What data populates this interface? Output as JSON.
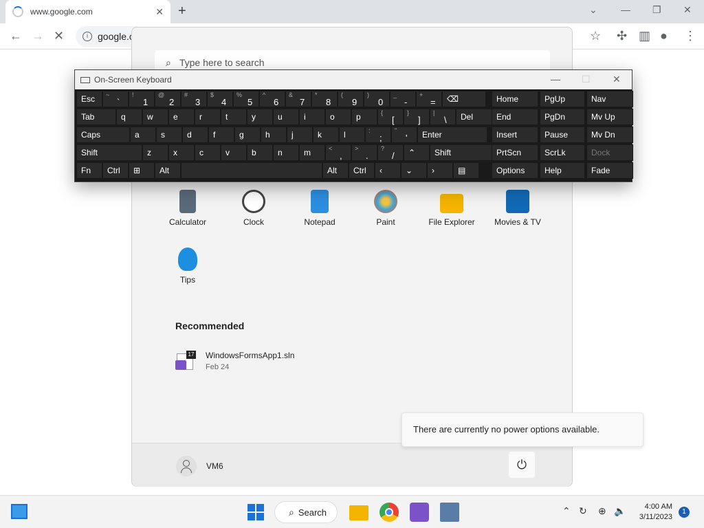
{
  "browser": {
    "tab_title": "www.google.com",
    "tab_close": "✕",
    "new_tab": "+",
    "url": "google.c"
  },
  "start_menu": {
    "search_placeholder": "Type here to search",
    "apps": [
      {
        "label": "Calculator",
        "icon": "calculator-icon",
        "color": "#5a6a7a"
      },
      {
        "label": "Clock",
        "icon": "clock-icon",
        "color": "#444444"
      },
      {
        "label": "Notepad",
        "icon": "notepad-icon",
        "color": "#2d8ee0"
      },
      {
        "label": "Paint",
        "icon": "paint-icon",
        "color": "#e36b2c"
      },
      {
        "label": "File Explorer",
        "icon": "folder-icon",
        "color": "#f4b400"
      },
      {
        "label": "Movies & TV",
        "icon": "movies-icon",
        "color": "#1269b5"
      },
      {
        "label": "Tips",
        "icon": "tips-icon",
        "color": "#1d8fe1"
      }
    ],
    "recommended_title": "Recommended",
    "recommended": [
      {
        "name": "WindowsFormsApp1.sln",
        "date": "Feb 24",
        "badge": "17"
      }
    ],
    "user": "VM6",
    "power_tooltip": "There are currently no power options available."
  },
  "osk": {
    "title": "On-Screen Keyboard",
    "rows": [
      [
        {
          "main": "Esc"
        },
        {
          "sub": "~",
          "bot": "`"
        },
        {
          "sub": "!",
          "bot": "1"
        },
        {
          "sub": "@",
          "bot": "2"
        },
        {
          "sub": "#",
          "bot": "3"
        },
        {
          "sub": "$",
          "bot": "4"
        },
        {
          "sub": "%",
          "bot": "5"
        },
        {
          "sub": "^",
          "bot": "6"
        },
        {
          "sub": "&",
          "bot": "7"
        },
        {
          "sub": "*",
          "bot": "8"
        },
        {
          "sub": "(",
          "bot": "9"
        },
        {
          "sub": ")",
          "bot": "0"
        },
        {
          "sub": "_",
          "bot": "-"
        },
        {
          "sub": "+",
          "bot": "="
        },
        {
          "main": "⌫"
        }
      ],
      [
        {
          "main": "Tab"
        },
        {
          "main": "q"
        },
        {
          "main": "w"
        },
        {
          "main": "e"
        },
        {
          "main": "r"
        },
        {
          "main": "t"
        },
        {
          "main": "y"
        },
        {
          "main": "u"
        },
        {
          "main": "i"
        },
        {
          "main": "o"
        },
        {
          "main": "p"
        },
        {
          "sub": "{",
          "bot": "["
        },
        {
          "sub": "}",
          "bot": "]"
        },
        {
          "sub": "|",
          "bot": "\\"
        },
        {
          "main": "Del"
        }
      ],
      [
        {
          "main": "Caps"
        },
        {
          "main": "a"
        },
        {
          "main": "s"
        },
        {
          "main": "d"
        },
        {
          "main": "f"
        },
        {
          "main": "g"
        },
        {
          "main": "h"
        },
        {
          "main": "j"
        },
        {
          "main": "k"
        },
        {
          "main": "l"
        },
        {
          "sub": ":",
          "bot": ";"
        },
        {
          "sub": "\"",
          "bot": "'"
        },
        {
          "main": "Enter"
        }
      ],
      [
        {
          "main": "Shift"
        },
        {
          "main": "z"
        },
        {
          "main": "x"
        },
        {
          "main": "c"
        },
        {
          "main": "v"
        },
        {
          "main": "b"
        },
        {
          "main": "n"
        },
        {
          "main": "m"
        },
        {
          "sub": "<",
          "bot": ","
        },
        {
          "sub": ">",
          "bot": "."
        },
        {
          "sub": "?",
          "bot": "/"
        },
        {
          "main": "⌃"
        },
        {
          "main": "Shift"
        }
      ],
      [
        {
          "main": "Fn"
        },
        {
          "main": "Ctrl"
        },
        {
          "main": "⊞"
        },
        {
          "main": "Alt"
        },
        {
          "main": ""
        },
        {
          "main": "Alt"
        },
        {
          "main": "Ctrl"
        },
        {
          "main": "‹"
        },
        {
          "main": "⌄"
        },
        {
          "main": "›"
        },
        {
          "main": "▤"
        }
      ]
    ],
    "side": [
      [
        "Home",
        "PgUp",
        "Nav"
      ],
      [
        "End",
        "PgDn",
        "Mv Up"
      ],
      [
        "Insert",
        "Pause",
        "Mv Dn"
      ],
      [
        "PrtScn",
        "ScrLk",
        "Dock"
      ],
      [
        "Options",
        "Help",
        "Fade"
      ]
    ]
  },
  "taskbar": {
    "search_label": "Search",
    "time": "4:00 AM",
    "date": "3/11/2023",
    "notification_count": "1"
  }
}
